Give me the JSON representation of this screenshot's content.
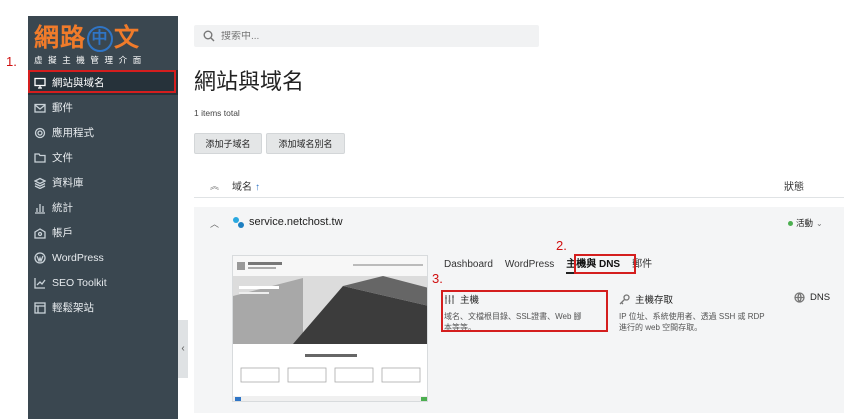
{
  "logo": {
    "prefix": "網路",
    "circle_char": "中",
    "suffix": "文",
    "subtitle": "虛擬主機管理介面"
  },
  "steps": [
    "1.",
    "2.",
    "3."
  ],
  "sidebar": {
    "items": [
      {
        "label": "網站與域名",
        "icon": "monitor-icon"
      },
      {
        "label": "郵件",
        "icon": "mail-icon"
      },
      {
        "label": "應用程式",
        "icon": "gear-icon"
      },
      {
        "label": "文件",
        "icon": "folder-icon"
      },
      {
        "label": "資料庫",
        "icon": "database-icon"
      },
      {
        "label": "統計",
        "icon": "bar-chart-icon"
      },
      {
        "label": "帳戶",
        "icon": "account-icon"
      },
      {
        "label": "WordPress",
        "icon": "wordpress-icon"
      },
      {
        "label": "SEO Toolkit",
        "icon": "seo-icon"
      },
      {
        "label": "輕鬆架站",
        "icon": "site-builder-icon"
      }
    ],
    "collapse_glyph": "‹"
  },
  "search": {
    "placeholder": "搜索中..."
  },
  "page": {
    "title": "網站與域名",
    "count": "1 items total",
    "buttons": {
      "add_subdomain": "添加子域名",
      "add_alias": "添加域名別名"
    }
  },
  "table": {
    "headers": {
      "name": "域名",
      "sort_arrow": "↑",
      "status": "狀態"
    },
    "row": {
      "domain": "service.netchost.tw",
      "status": "活動",
      "tabs": [
        "Dashboard",
        "WordPress",
        "主機與 DNS",
        "郵件"
      ],
      "selected_tab": 2,
      "cards": [
        {
          "title": "主機",
          "desc_line1": "域名、文檔根目錄、SSL證書、Web 腳",
          "desc_line2": "本等等。",
          "icon": "hosting-icon"
        },
        {
          "title": "主機存取",
          "desc_line1": "IP 位址、系統使用者、透過 SSH 或 RDP",
          "desc_line2": "進行的 web 空間存取。",
          "icon": "key-icon"
        },
        {
          "title": "DNS",
          "icon": "globe-icon"
        }
      ]
    }
  },
  "colors": {
    "sidebar": "#3a4750",
    "logo_orange": "#f07b2a",
    "logo_blue": "#2f75c6",
    "highlight": "#d41e1e",
    "active_dot": "#4caf50"
  }
}
